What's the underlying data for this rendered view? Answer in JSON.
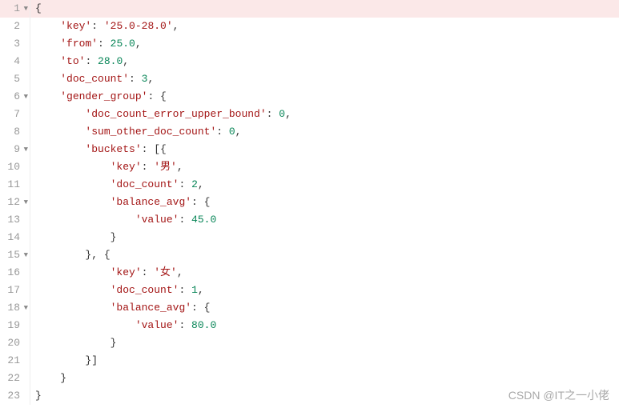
{
  "lines": [
    {
      "n": 1,
      "fold": true,
      "hl": true,
      "indent": 0,
      "tokens": [
        [
          "punct",
          "{"
        ]
      ]
    },
    {
      "n": 2,
      "fold": false,
      "hl": false,
      "indent": 1,
      "tokens": [
        [
          "key",
          "'key'"
        ],
        [
          "punct",
          ": "
        ],
        [
          "key",
          "'25.0-28.0'"
        ],
        [
          "punct",
          ","
        ]
      ]
    },
    {
      "n": 3,
      "fold": false,
      "hl": false,
      "indent": 1,
      "tokens": [
        [
          "key",
          "'from'"
        ],
        [
          "punct",
          ": "
        ],
        [
          "num",
          "25.0"
        ],
        [
          "punct",
          ","
        ]
      ]
    },
    {
      "n": 4,
      "fold": false,
      "hl": false,
      "indent": 1,
      "tokens": [
        [
          "key",
          "'to'"
        ],
        [
          "punct",
          ": "
        ],
        [
          "num",
          "28.0"
        ],
        [
          "punct",
          ","
        ]
      ]
    },
    {
      "n": 5,
      "fold": false,
      "hl": false,
      "indent": 1,
      "tokens": [
        [
          "key",
          "'doc_count'"
        ],
        [
          "punct",
          ": "
        ],
        [
          "num",
          "3"
        ],
        [
          "punct",
          ","
        ]
      ]
    },
    {
      "n": 6,
      "fold": true,
      "hl": false,
      "indent": 1,
      "tokens": [
        [
          "key",
          "'gender_group'"
        ],
        [
          "punct",
          ": {"
        ]
      ]
    },
    {
      "n": 7,
      "fold": false,
      "hl": false,
      "indent": 2,
      "tokens": [
        [
          "key",
          "'doc_count_error_upper_bound'"
        ],
        [
          "punct",
          ": "
        ],
        [
          "num",
          "0"
        ],
        [
          "punct",
          ","
        ]
      ]
    },
    {
      "n": 8,
      "fold": false,
      "hl": false,
      "indent": 2,
      "tokens": [
        [
          "key",
          "'sum_other_doc_count'"
        ],
        [
          "punct",
          ": "
        ],
        [
          "num",
          "0"
        ],
        [
          "punct",
          ","
        ]
      ]
    },
    {
      "n": 9,
      "fold": true,
      "hl": false,
      "indent": 2,
      "tokens": [
        [
          "key",
          "'buckets'"
        ],
        [
          "punct",
          ": [{"
        ]
      ]
    },
    {
      "n": 10,
      "fold": false,
      "hl": false,
      "indent": 3,
      "tokens": [
        [
          "key",
          "'key'"
        ],
        [
          "punct",
          ": "
        ],
        [
          "key",
          "'男'"
        ],
        [
          "punct",
          ","
        ]
      ]
    },
    {
      "n": 11,
      "fold": false,
      "hl": false,
      "indent": 3,
      "tokens": [
        [
          "key",
          "'doc_count'"
        ],
        [
          "punct",
          ": "
        ],
        [
          "num",
          "2"
        ],
        [
          "punct",
          ","
        ]
      ]
    },
    {
      "n": 12,
      "fold": true,
      "hl": false,
      "indent": 3,
      "tokens": [
        [
          "key",
          "'balance_avg'"
        ],
        [
          "punct",
          ": {"
        ]
      ]
    },
    {
      "n": 13,
      "fold": false,
      "hl": false,
      "indent": 4,
      "tokens": [
        [
          "key",
          "'value'"
        ],
        [
          "punct",
          ": "
        ],
        [
          "num",
          "45.0"
        ]
      ]
    },
    {
      "n": 14,
      "fold": false,
      "hl": false,
      "indent": 3,
      "tokens": [
        [
          "punct",
          "}"
        ]
      ]
    },
    {
      "n": 15,
      "fold": true,
      "hl": false,
      "indent": 2,
      "tokens": [
        [
          "punct",
          "}, {"
        ]
      ]
    },
    {
      "n": 16,
      "fold": false,
      "hl": false,
      "indent": 3,
      "tokens": [
        [
          "key",
          "'key'"
        ],
        [
          "punct",
          ": "
        ],
        [
          "key",
          "'女'"
        ],
        [
          "punct",
          ","
        ]
      ]
    },
    {
      "n": 17,
      "fold": false,
      "hl": false,
      "indent": 3,
      "tokens": [
        [
          "key",
          "'doc_count'"
        ],
        [
          "punct",
          ": "
        ],
        [
          "num",
          "1"
        ],
        [
          "punct",
          ","
        ]
      ]
    },
    {
      "n": 18,
      "fold": true,
      "hl": false,
      "indent": 3,
      "tokens": [
        [
          "key",
          "'balance_avg'"
        ],
        [
          "punct",
          ": {"
        ]
      ]
    },
    {
      "n": 19,
      "fold": false,
      "hl": false,
      "indent": 4,
      "tokens": [
        [
          "key",
          "'value'"
        ],
        [
          "punct",
          ": "
        ],
        [
          "num",
          "80.0"
        ]
      ]
    },
    {
      "n": 20,
      "fold": false,
      "hl": false,
      "indent": 3,
      "tokens": [
        [
          "punct",
          "}"
        ]
      ]
    },
    {
      "n": 21,
      "fold": false,
      "hl": false,
      "indent": 2,
      "tokens": [
        [
          "punct",
          "}]"
        ]
      ]
    },
    {
      "n": 22,
      "fold": false,
      "hl": false,
      "indent": 1,
      "tokens": [
        [
          "punct",
          "}"
        ]
      ]
    },
    {
      "n": 23,
      "fold": false,
      "hl": false,
      "indent": 0,
      "tokens": [
        [
          "punct",
          "}"
        ]
      ]
    }
  ],
  "foldGlyph": "▼",
  "indentUnit": "    ",
  "watermark": "CSDN @IT之一小佬"
}
